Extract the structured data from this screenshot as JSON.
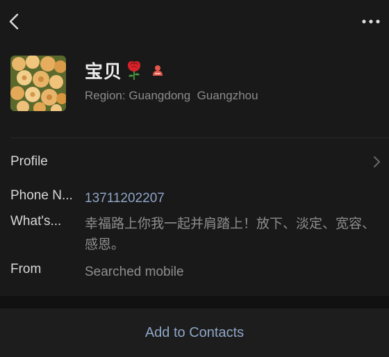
{
  "header": {
    "back_icon": "chevron-left-icon",
    "more_icon": "more-horizontal-icon"
  },
  "profile": {
    "name": "宝贝",
    "name_emoji": "rose",
    "badge_icon": "red-figure-badge-icon",
    "region_label": "Region:",
    "region_value": "Guangdong  Guangzhou"
  },
  "details": {
    "profile_label": "Profile",
    "phone_label": "Phone N...",
    "phone_value": "13711202207",
    "whats_label": "What's...",
    "whats_value": "幸福路上你我一起并肩踏上！放下、淡定、宽容、感恩。",
    "from_label": "From",
    "from_value": "Searched mobile"
  },
  "actions": {
    "add_contacts": "Add to Contacts"
  },
  "colors": {
    "background": "#191919",
    "link": "#8ea6c7",
    "secondary_text": "#8c8c8c"
  }
}
